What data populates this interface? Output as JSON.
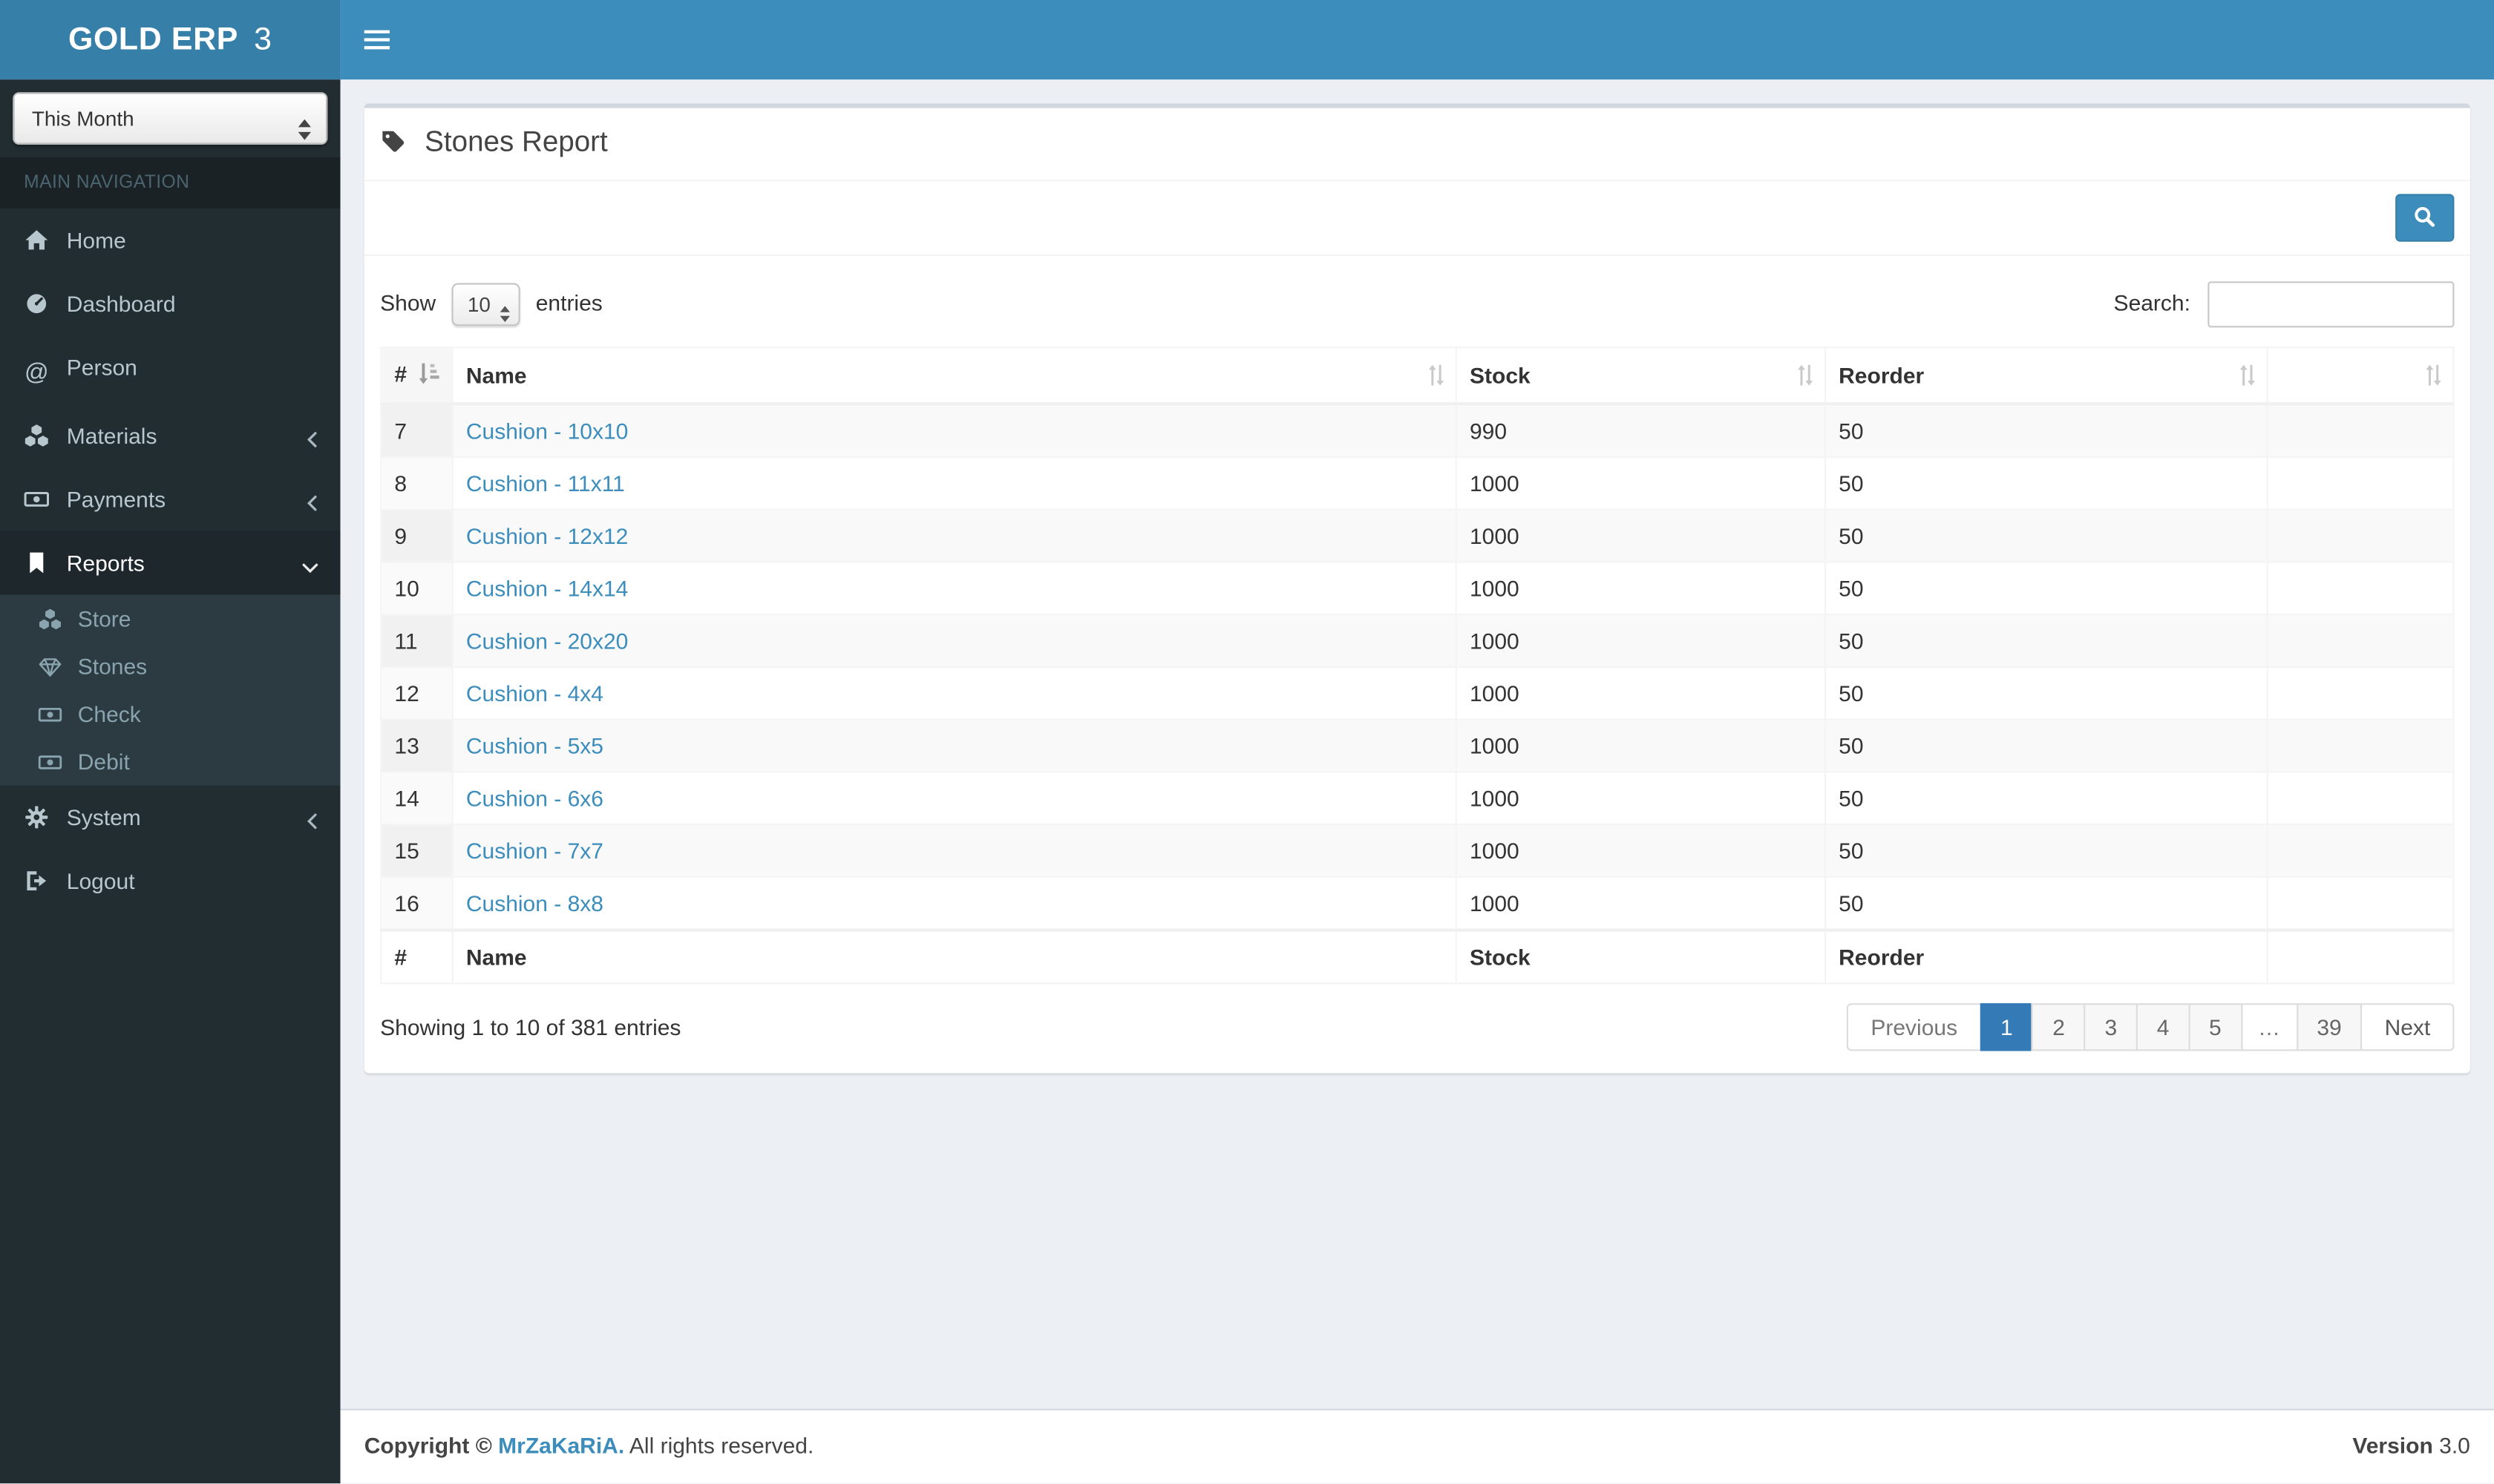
{
  "brand": {
    "bold": "GOLD ERP",
    "thin": "3"
  },
  "sidebar": {
    "filter_value": "This Month",
    "section_header": "MAIN NAVIGATION",
    "items": {
      "home": "Home",
      "dashboard": "Dashboard",
      "person": "Person",
      "materials": "Materials",
      "payments": "Payments",
      "reports": "Reports",
      "store": "Store",
      "stones": "Stones",
      "check": "Check",
      "debit": "Debit",
      "system": "System",
      "logout": "Logout"
    },
    "at_glyph": "@"
  },
  "page": {
    "title": "Stones Report"
  },
  "table": {
    "show_label": "Show",
    "entries_label": "entries",
    "page_length": "10",
    "search_label": "Search:",
    "search_value": "",
    "columns": [
      "#",
      "Name",
      "Stock",
      "Reorder",
      ""
    ],
    "rows": [
      {
        "num": "7",
        "name": "Cushion - 10x10",
        "stock": "990",
        "reorder": "50"
      },
      {
        "num": "8",
        "name": "Cushion - 11x11",
        "stock": "1000",
        "reorder": "50"
      },
      {
        "num": "9",
        "name": "Cushion - 12x12",
        "stock": "1000",
        "reorder": "50"
      },
      {
        "num": "10",
        "name": "Cushion - 14x14",
        "stock": "1000",
        "reorder": "50"
      },
      {
        "num": "11",
        "name": "Cushion - 20x20",
        "stock": "1000",
        "reorder": "50"
      },
      {
        "num": "12",
        "name": "Cushion - 4x4",
        "stock": "1000",
        "reorder": "50"
      },
      {
        "num": "13",
        "name": "Cushion - 5x5",
        "stock": "1000",
        "reorder": "50"
      },
      {
        "num": "14",
        "name": "Cushion - 6x6",
        "stock": "1000",
        "reorder": "50"
      },
      {
        "num": "15",
        "name": "Cushion - 7x7",
        "stock": "1000",
        "reorder": "50"
      },
      {
        "num": "16",
        "name": "Cushion - 8x8",
        "stock": "1000",
        "reorder": "50"
      }
    ],
    "info": "Showing 1 to 10 of 381 entries",
    "pagination": {
      "previous": "Previous",
      "pages": [
        "1",
        "2",
        "3",
        "4",
        "5",
        "…",
        "39"
      ],
      "active_page": "1",
      "next": "Next"
    }
  },
  "footer": {
    "copyright_bold": "Copyright ©",
    "owner": "MrZaKaRiA.",
    "rights": "All rights reserved.",
    "version_label": "Version",
    "version_value": "3.0"
  },
  "colors": {
    "navbar": "#3c8dbc",
    "logo_bg": "#367fa9",
    "sidebar_bg": "#222d32",
    "submenu_bg": "#2c3b41",
    "body_bg": "#ecf0f5",
    "link": "#3c8dbc",
    "active_page": "#337ab7"
  }
}
